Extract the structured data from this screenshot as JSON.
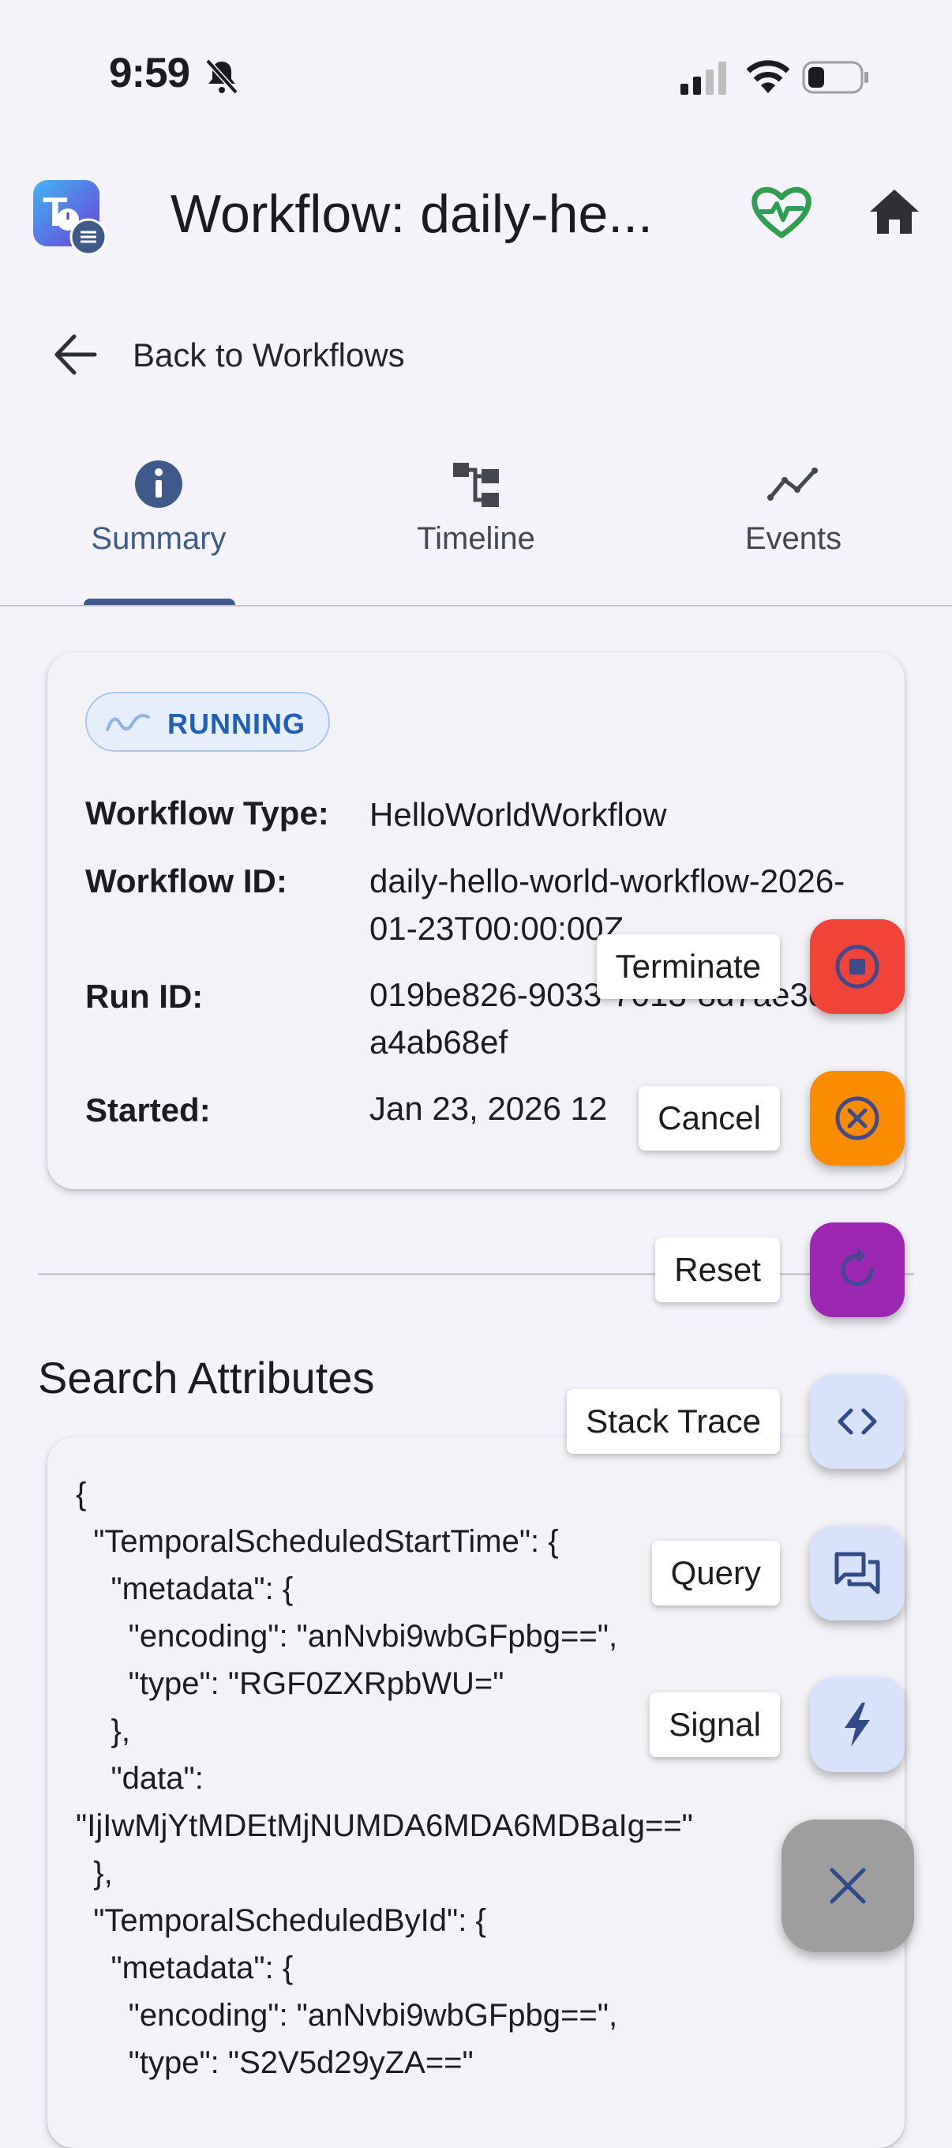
{
  "status_bar": {
    "time": "9:59"
  },
  "app_bar": {
    "title": "Workflow: daily-he..."
  },
  "back": {
    "label": "Back to Workflows"
  },
  "tabs": [
    {
      "label": "Summary",
      "icon": "info-icon",
      "active": true
    },
    {
      "label": "Timeline",
      "icon": "timeline-icon",
      "active": false
    },
    {
      "label": "Events",
      "icon": "events-chart-icon",
      "active": false
    }
  ],
  "summary": {
    "status": "RUNNING",
    "fields": [
      {
        "label": "Workflow Type:",
        "value": "HelloWorldWorkflow"
      },
      {
        "label": "Workflow ID:",
        "value": "daily-hello-world-workflow-2026-01-23T00:00:00Z"
      },
      {
        "label": "Run ID:",
        "value": "019be826-9033-7013-8d7ae3e3a4ab68ef"
      },
      {
        "label": "Started:",
        "value": "Jan 23, 2026 12"
      }
    ]
  },
  "search_attributes": {
    "title": "Search Attributes",
    "json": "{\n  \"TemporalScheduledStartTime\": {\n    \"metadata\": {\n      \"encoding\": \"anNvbi9wbGFpbg==\",\n      \"type\": \"RGF0ZXRpbWU=\"\n    },\n    \"data\":\n\"IjIwMjYtMDEtMjNUMDA6MDA6MDBaIg==\"\n  },\n  \"TemporalScheduledById\": {\n    \"metadata\": {\n      \"encoding\": \"anNvbi9wbGFpbg==\",\n      \"type\": \"S2V5d29yZA==\""
  },
  "actions": [
    {
      "label": "Terminate",
      "icon": "stop-icon",
      "color": "#f04438"
    },
    {
      "label": "Cancel",
      "icon": "cancel-circle-icon",
      "color": "#fb8c00"
    },
    {
      "label": "Reset",
      "icon": "reset-icon",
      "color": "#9c27b0"
    },
    {
      "label": "Stack Trace",
      "icon": "code-icon",
      "color": "#d8e2fb"
    },
    {
      "label": "Query",
      "icon": "chat-icon",
      "color": "#d8e2fb"
    },
    {
      "label": "Signal",
      "icon": "bolt-icon",
      "color": "#d8e2fb"
    }
  ],
  "colors": {
    "accent": "#3d5a8a",
    "running": "#1f5fb8",
    "health": "#2e9e4f"
  }
}
